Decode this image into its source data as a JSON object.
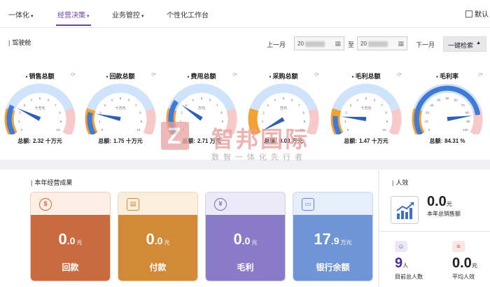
{
  "nav": {
    "tabs": [
      {
        "label": "一体化",
        "active": false
      },
      {
        "label": "经营决策",
        "active": true
      },
      {
        "label": "业务管控",
        "active": false
      },
      {
        "label": "个性化工作台",
        "active": false
      }
    ],
    "default_label": "默认"
  },
  "dashboard": {
    "title": "驾驶舱",
    "prev_month": "上一月",
    "next_month": "下一月",
    "date_from": "20",
    "date_sep": "至",
    "date_to": "20",
    "search_label": "一键检索",
    "gauges": [
      {
        "label": "销售总额",
        "unit": "十万元",
        "total_prefix": "总额:",
        "total_value": "2.32 十万元",
        "value": 2.32,
        "max": 10
      },
      {
        "label": "回款总额",
        "unit": "十万元",
        "total_prefix": "总额:",
        "total_value": "1.75 十万元",
        "value": 1.75,
        "max": 10
      },
      {
        "label": "费用总额",
        "unit": "万元",
        "total_prefix": "总额:",
        "total_value": "2.71 万元",
        "value": 2.71,
        "max": 10
      },
      {
        "label": "采购总额",
        "unit": "万元",
        "total_prefix": "总额:",
        "total_value": "0.03 万元",
        "value": 0.03,
        "max": 10
      },
      {
        "label": "毛利总额",
        "unit": "十万元",
        "total_prefix": "总额:",
        "total_value": "1.47 十万元",
        "value": 1.47,
        "max": 10
      },
      {
        "label": "毛利率",
        "unit": "",
        "total_prefix": "总额:",
        "total_value": "84.31 %",
        "value": 84.31,
        "max": 100
      }
    ]
  },
  "watermark": {
    "main": "智邦国际",
    "sub": "数智一体化先行者"
  },
  "results": {
    "title": "本年经营成果",
    "cards": [
      {
        "name": "回款",
        "int": "0",
        "dec": ".0",
        "unit": "元",
        "icon": "currency-circle-icon",
        "glyph": "$",
        "top_bg": "#fdeee6",
        "bot_bg": "#c96a3f",
        "icon_color": "#d2693c"
      },
      {
        "name": "付款",
        "int": "0",
        "dec": ".0",
        "unit": "元",
        "icon": "payment-doc-icon",
        "glyph": "▤",
        "top_bg": "#fbeedd",
        "bot_bg": "#d28a38",
        "icon_color": "#d28a38"
      },
      {
        "name": "毛利",
        "int": "0",
        "dec": ".0",
        "unit": "元",
        "icon": "yen-circle-icon",
        "glyph": "¥",
        "top_bg": "#ece9f8",
        "bot_bg": "#8a7bc8",
        "icon_color": "#7b6bbd"
      },
      {
        "name": "银行余额",
        "int": "17",
        "dec": ".9",
        "unit": "万元",
        "icon": "wallet-icon",
        "glyph": "▭",
        "top_bg": "#e6eefb",
        "bot_bg": "#6f95d6",
        "icon_color": "#5f86cc"
      }
    ]
  },
  "people": {
    "title": "人效",
    "total_value": "0.0",
    "total_unit": "元",
    "total_label": "本年总销售额",
    "count_value": "9",
    "count_unit": "人",
    "count_label": "目前总人数",
    "avg_value": "0.0",
    "avg_unit": "元",
    "avg_label": "平均人效"
  }
}
